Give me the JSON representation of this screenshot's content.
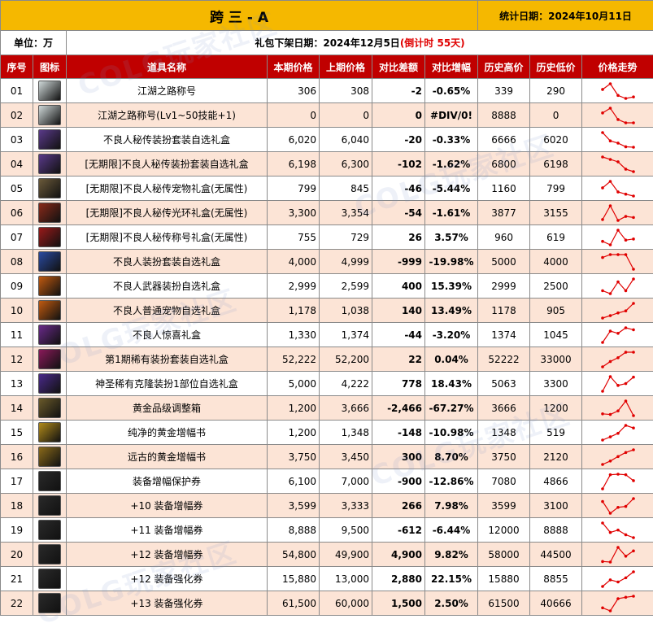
{
  "header": {
    "title": "跨 三 - A",
    "stat_date": "统计日期：2024年10月11日",
    "unit": "单位：万",
    "notice": "礼包下架日期：2024年12月5日",
    "countdown": "(倒计时 55天)"
  },
  "columns": [
    "序号",
    "图标",
    "道具名称",
    "本期价格",
    "上期价格",
    "对比差额",
    "对比增幅",
    "历史高价",
    "历史低价",
    "价格走势"
  ],
  "watermark": "COLG玩家社区",
  "rows": [
    {
      "no": "01",
      "icon": "title-icon",
      "color": "#cfd8d8",
      "name": "江湖之路称号",
      "cur": "306",
      "prev": "308",
      "diff": "-2",
      "pct": "-0.65%",
      "high": "339",
      "low": "290",
      "trend": [
        320,
        339,
        300,
        290,
        295
      ]
    },
    {
      "no": "02",
      "icon": "title-icon",
      "color": "#cfd8d8",
      "name": "江湖之路称号(Lv1~50技能+1)",
      "cur": "0",
      "prev": "0",
      "diff": "0",
      "pct": "#DIV/0!",
      "high": "8888",
      "low": "0",
      "trend": [
        6000,
        8888,
        2000,
        0,
        0
      ]
    },
    {
      "no": "03",
      "icon": "outfit-box-icon",
      "color": "#5a3a8a",
      "name": "不良人秘传装扮套装自选礼盒",
      "cur": "6,020",
      "prev": "6,040",
      "diff": "-20",
      "pct": "-0.33%",
      "high": "6666",
      "low": "6020",
      "trend": [
        6666,
        6300,
        6200,
        6040,
        6020
      ]
    },
    {
      "no": "04",
      "icon": "outfit-box-icon",
      "color": "#5a3a8a",
      "name": "[无期限]不良人秘传装扮套装自选礼盒",
      "cur": "6,198",
      "prev": "6,300",
      "diff": "-102",
      "pct": "-1.62%",
      "high": "6800",
      "low": "6198",
      "trend": [
        6800,
        6700,
        6600,
        6300,
        6198
      ]
    },
    {
      "no": "05",
      "icon": "pet-box-icon",
      "color": "#6b5a3a",
      "name": "[无期限]不良人秘传宠物礼盒(无属性)",
      "cur": "799",
      "prev": "845",
      "diff": "-46",
      "pct": "-5.44%",
      "high": "1160",
      "low": "799",
      "trend": [
        1000,
        1160,
        900,
        845,
        799
      ]
    },
    {
      "no": "06",
      "icon": "aura-box-icon",
      "color": "#8a2a1a",
      "name": "[无期限]不良人秘传光环礼盒(无属性)",
      "cur": "3,300",
      "prev": "3,354",
      "diff": "-54",
      "pct": "-1.61%",
      "high": "3877",
      "low": "3155",
      "trend": [
        3200,
        3877,
        3155,
        3354,
        3300
      ]
    },
    {
      "no": "07",
      "icon": "title-box-icon",
      "color": "#9a1a1a",
      "name": "[无期限]不良人秘传称号礼盒(无属性)",
      "cur": "755",
      "prev": "729",
      "diff": "26",
      "pct": "3.57%",
      "high": "960",
      "low": "619",
      "trend": [
        700,
        619,
        960,
        729,
        755
      ]
    },
    {
      "no": "08",
      "icon": "outfit-box-icon",
      "color": "#2a4aa0",
      "name": "不良人装扮套装自选礼盒",
      "cur": "4,000",
      "prev": "4,999",
      "diff": "-999",
      "pct": "-19.98%",
      "high": "5000",
      "low": "4000",
      "trend": [
        4800,
        5000,
        4999,
        4999,
        4000
      ]
    },
    {
      "no": "09",
      "icon": "weapon-box-icon",
      "color": "#c05a10",
      "name": "不良人武器装扮自选礼盒",
      "cur": "2,999",
      "prev": "2,599",
      "diff": "400",
      "pct": "15.39%",
      "high": "2999",
      "low": "2500",
      "trend": [
        2600,
        2500,
        2900,
        2599,
        2999
      ]
    },
    {
      "no": "10",
      "icon": "pet-box-icon",
      "color": "#c05a10",
      "name": "不良人普通宠物自选礼盒",
      "cur": "1,178",
      "prev": "1,038",
      "diff": "140",
      "pct": "13.49%",
      "high": "1178",
      "low": "905",
      "trend": [
        905,
        950,
        1000,
        1038,
        1178
      ]
    },
    {
      "no": "11",
      "icon": "surprise-box-icon",
      "color": "#6a2a8a",
      "name": "不良人惊喜礼盒",
      "cur": "1,330",
      "prev": "1,374",
      "diff": "-44",
      "pct": "-3.20%",
      "high": "1374",
      "low": "1045",
      "trend": [
        1045,
        1300,
        1250,
        1374,
        1330
      ]
    },
    {
      "no": "12",
      "icon": "outfit-box-icon",
      "color": "#8a1a5a",
      "name": "第1期稀有装扮套装自选礼盒",
      "cur": "52,222",
      "prev": "52,200",
      "diff": "22",
      "pct": "0.04%",
      "high": "52222",
      "low": "33000",
      "trend": [
        33000,
        40000,
        45000,
        52200,
        52222
      ]
    },
    {
      "no": "13",
      "icon": "clone-box-icon",
      "color": "#4a2a8a",
      "name": "神圣稀有克隆装扮1部位自选礼盒",
      "cur": "5,000",
      "prev": "4,222",
      "diff": "778",
      "pct": "18.43%",
      "high": "5063",
      "low": "3300",
      "trend": [
        3300,
        5063,
        4000,
        4222,
        5000
      ]
    },
    {
      "no": "14",
      "icon": "adjust-box-icon",
      "color": "#6a5a2a",
      "name": "黄金品级调整箱",
      "cur": "1,200",
      "prev": "3,666",
      "diff": "-2,466",
      "pct": "-67.27%",
      "high": "3666",
      "low": "1200",
      "trend": [
        1500,
        1400,
        2000,
        3666,
        1200
      ]
    },
    {
      "no": "15",
      "icon": "amplify-book-icon",
      "color": "#b08a1a",
      "name": "纯净的黄金增幅书",
      "cur": "1,200",
      "prev": "1,348",
      "diff": "-148",
      "pct": "-10.98%",
      "high": "1348",
      "low": "519",
      "trend": [
        519,
        700,
        900,
        1348,
        1200
      ]
    },
    {
      "no": "16",
      "icon": "amplify-book-icon",
      "color": "#8a6a1a",
      "name": "远古的黄金增幅书",
      "cur": "3,750",
      "prev": "3,450",
      "diff": "300",
      "pct": "8.70%",
      "high": "3750",
      "low": "2120",
      "trend": [
        2120,
        2500,
        3000,
        3450,
        3750
      ]
    },
    {
      "no": "17",
      "icon": "protect-ticket-icon",
      "color": "#2a2a2a",
      "name": "装备增幅保护券",
      "cur": "6,100",
      "prev": "7,000",
      "diff": "-900",
      "pct": "-12.86%",
      "high": "7080",
      "low": "4866",
      "trend": [
        4866,
        7000,
        7080,
        7000,
        6100
      ]
    },
    {
      "no": "18",
      "icon": "amplify-ticket-icon",
      "color": "#2a2a2a",
      "name": "+10 装备增幅券",
      "cur": "3,599",
      "prev": "3,333",
      "diff": "266",
      "pct": "7.98%",
      "high": "3599",
      "low": "3100",
      "trend": [
        3500,
        3100,
        3300,
        3333,
        3599
      ]
    },
    {
      "no": "19",
      "icon": "amplify-ticket-icon",
      "color": "#2a2a2a",
      "name": "+11 装备增幅券",
      "cur": "8,888",
      "prev": "9,500",
      "diff": "-612",
      "pct": "-6.44%",
      "high": "12000",
      "low": "8888",
      "trend": [
        12000,
        10000,
        10500,
        9500,
        8888
      ]
    },
    {
      "no": "20",
      "icon": "amplify-ticket-icon",
      "color": "#2a2a2a",
      "name": "+12 装备增幅券",
      "cur": "54,800",
      "prev": "49,900",
      "diff": "4,900",
      "pct": "9.82%",
      "high": "58000",
      "low": "44500",
      "trend": [
        45000,
        44500,
        58000,
        49900,
        54800
      ]
    },
    {
      "no": "21",
      "icon": "refine-ticket-icon",
      "color": "#2a2a2a",
      "name": "+12 装备强化券",
      "cur": "15,880",
      "prev": "13,000",
      "diff": "2,880",
      "pct": "22.15%",
      "high": "15880",
      "low": "8855",
      "trend": [
        8855,
        12000,
        11000,
        13000,
        15880
      ]
    },
    {
      "no": "22",
      "icon": "refine-ticket-icon",
      "color": "#2a2a2a",
      "name": "+13 装备强化券",
      "cur": "61,500",
      "prev": "60,000",
      "diff": "1,500",
      "pct": "2.50%",
      "high": "61500",
      "low": "40666",
      "trend": [
        45000,
        40666,
        58000,
        60000,
        61500
      ]
    }
  ]
}
